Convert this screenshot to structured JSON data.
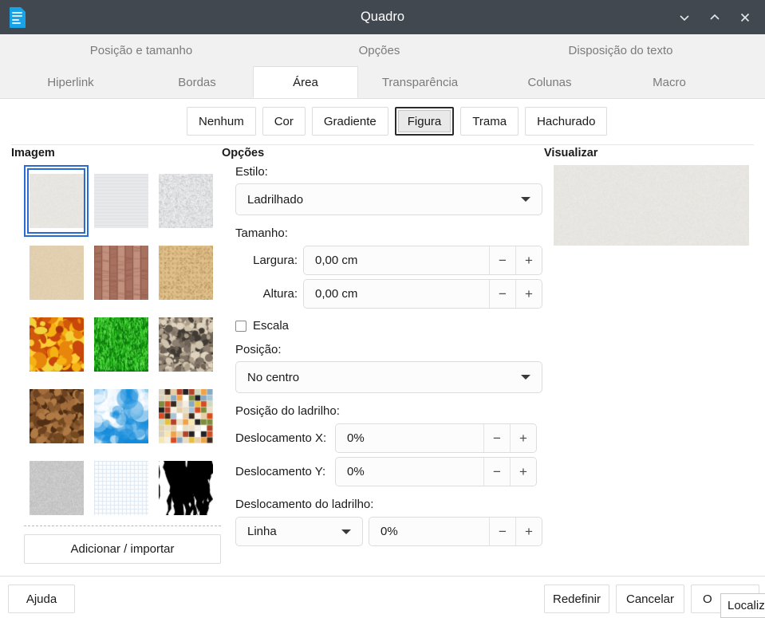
{
  "window": {
    "title": "Quadro",
    "icon": "writer-document-icon",
    "controls": [
      {
        "name": "minimize-button",
        "glyph": "chevron-down"
      },
      {
        "name": "maximize-button",
        "glyph": "chevron-up"
      },
      {
        "name": "close-button",
        "glyph": "close-x"
      }
    ]
  },
  "tabs": {
    "row1": [
      {
        "label": "Posição e tamanho",
        "active": false
      },
      {
        "label": "Opções",
        "active": false
      },
      {
        "label": "Disposição do texto",
        "active": false
      }
    ],
    "row2": [
      {
        "label": "Hiperlink",
        "active": false
      },
      {
        "label": "Bordas",
        "active": false
      },
      {
        "label": "Área",
        "active": true
      },
      {
        "label": "Transparência",
        "active": false
      },
      {
        "label": "Colunas",
        "active": false
      },
      {
        "label": "Macro",
        "active": false
      }
    ]
  },
  "fill_modes": [
    {
      "label": "Nenhum",
      "selected": false
    },
    {
      "label": "Cor",
      "selected": false
    },
    {
      "label": "Gradiente",
      "selected": false
    },
    {
      "label": "Figura",
      "selected": true
    },
    {
      "label": "Trama",
      "selected": false
    },
    {
      "label": "Hachurado",
      "selected": false
    }
  ],
  "gallery": {
    "heading": "Imagem",
    "add_button": "Adicionar / importar",
    "selected_index": 0,
    "items": [
      {
        "name": "painted-white",
        "c1": "#eceae6",
        "c2": "#dedbd5",
        "kind": "noise"
      },
      {
        "name": "fine-texture-white",
        "c1": "#e9eaec",
        "c2": "#d6d8dc",
        "kind": "hlines"
      },
      {
        "name": "rough-white-wall",
        "c1": "#f2f2f3",
        "c2": "#cfd1d4",
        "kind": "rough"
      },
      {
        "name": "invoice-paper",
        "c1": "#e6d4b6",
        "c2": "#d8c3a0",
        "kind": "noise"
      },
      {
        "name": "parchment-paper",
        "c1": "#c4907e",
        "c2": "#a8705e",
        "kind": "vlines"
      },
      {
        "name": "cardboard",
        "c1": "#e0c08a",
        "c2": "#cfae76",
        "kind": "dots"
      },
      {
        "name": "maple-leaves",
        "c1": "#f2a80f",
        "c2": "#c1450a",
        "kind": "leaves"
      },
      {
        "name": "lawn",
        "c1": "#2ec022",
        "c2": "#0d7a0c",
        "kind": "grass"
      },
      {
        "name": "pebble-stone",
        "c1": "#b9a893",
        "c2": "#6f6356",
        "kind": "pebbles"
      },
      {
        "name": "coffee-beans",
        "c1": "#8a5a30",
        "c2": "#4a2c13",
        "kind": "beans"
      },
      {
        "name": "sky",
        "c1": "#35b8f5",
        "c2": "#0a8fe0",
        "kind": "clouds"
      },
      {
        "name": "color-stripes",
        "c1": "#f4efe2",
        "c2": "#d84b20",
        "kind": "mosaic"
      },
      {
        "name": "concrete",
        "c1": "#d3d3d3",
        "c2": "#a9a9a9",
        "kind": "noise"
      },
      {
        "name": "paper-graph",
        "c1": "#fdfeff",
        "c2": "#dbe7f2",
        "kind": "grid"
      },
      {
        "name": "zebra",
        "c1": "#ffffff",
        "c2": "#000000",
        "kind": "zebra"
      }
    ]
  },
  "options": {
    "heading": "Opções",
    "style_label": "Estilo:",
    "style_value": "Ladrilhado",
    "size_label": "Tamanho:",
    "width_label": "Largura:",
    "width_value": "0,00 cm",
    "height_label": "Altura:",
    "height_value": "0,00 cm",
    "scale_label": "Escala",
    "scale_checked": false,
    "position_label": "Posição:",
    "position_value": "No centro",
    "tile_position_label": "Posição do ladrilho:",
    "offset_x_label": "Deslocamento X:",
    "offset_x_value": "0%",
    "offset_y_label": "Deslocamento Y:",
    "offset_y_value": "0%",
    "tile_offset_label": "Deslocamento do ladrilho:",
    "tile_offset_mode": "Linha",
    "tile_offset_value": "0%",
    "spin_minus": "−",
    "spin_plus": "+"
  },
  "preview": {
    "heading": "Visualizar",
    "texture": "painted-white"
  },
  "footer": {
    "help": "Ajuda",
    "reset": "Redefinir",
    "cancel": "Cancelar",
    "ok": "O",
    "tooltip": "Localiza"
  },
  "colors": {
    "titlebar_bg": "#414850",
    "tabstrip_bg": "#f1f1f1",
    "content_bg": "#ffffff",
    "selection_blue": "#2a6ad4",
    "text": "#1a1a1a",
    "muted_text": "#7b7b7b",
    "border": "#dcdcdc"
  }
}
